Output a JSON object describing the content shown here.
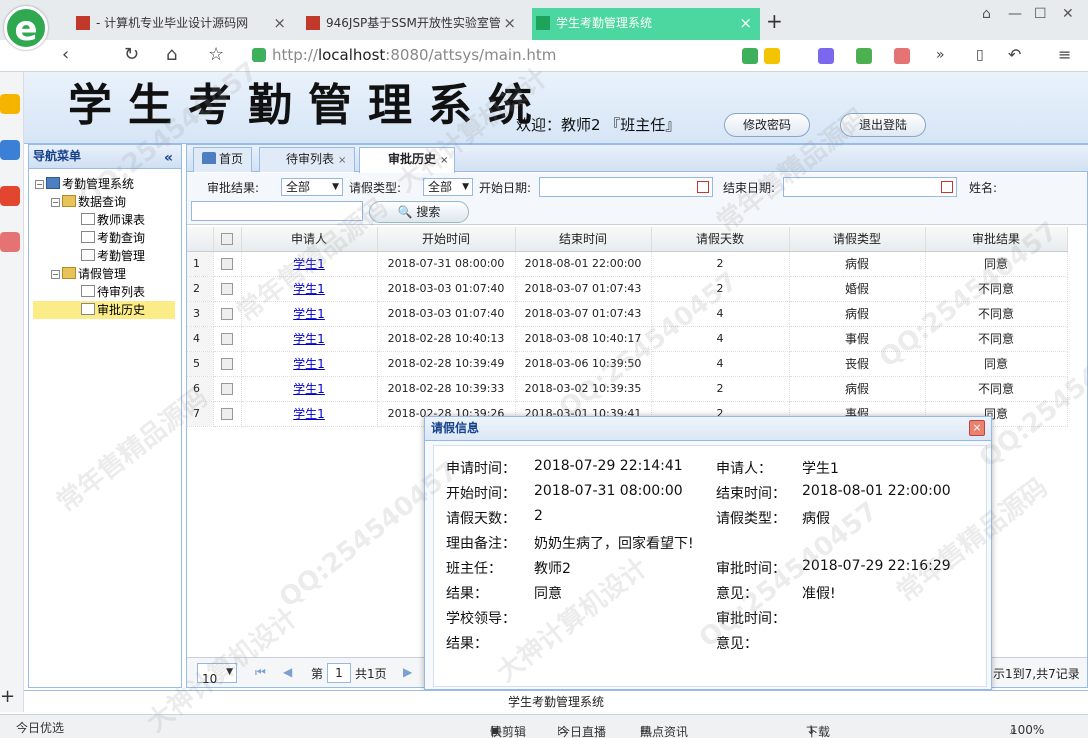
{
  "browser": {
    "tabs": [
      {
        "label": "- 计算机专业毕业设计源码网"
      },
      {
        "label": "946JSP基于SSM开放性实验室管"
      },
      {
        "label": "学生考勤管理系统"
      }
    ],
    "url_host": "http://",
    "url_domain": "localhost",
    "url_path": ":8080/attsys/main.htm",
    "status": {
      "left": "今日优选",
      "kuaijianji": "快剪辑",
      "zhibo": "今日直播",
      "hotnews": "热点资讯",
      "download": "下载",
      "zoom": "100%"
    }
  },
  "header": {
    "title": "学生考勤管理系统",
    "welcome": "欢迎：教师2 『班主任』",
    "change_password": "修改密码",
    "logout": "退出登陆"
  },
  "nav": {
    "title": "导航菜单",
    "collapse": "«",
    "root": "考勤管理系统",
    "group1": "数据查询",
    "g1_item1": "教师课表",
    "g1_item2": "考勤查询",
    "g1_item3": "考勤管理",
    "group2": "请假管理",
    "g2_item1": "待审列表",
    "g2_item2": "审批历史"
  },
  "tabs": {
    "home": "首页",
    "pending": "待审列表",
    "history": "审批历史",
    "close": "×"
  },
  "filter": {
    "result_label": "审批结果:",
    "result_value": "全部",
    "type_label": "请假类型:",
    "type_value": "全部",
    "start_label": "开始日期:",
    "end_label": "结束日期:",
    "name_label": "姓名:",
    "search": "搜索"
  },
  "table": {
    "headers": [
      "申请人",
      "开始时间",
      "结束时间",
      "请假天数",
      "请假类型",
      "审批结果"
    ],
    "rows": [
      {
        "n": "1",
        "name": "学生1",
        "start": "2018-07-31 08:00:00",
        "end": "2018-08-01 22:00:00",
        "days": "2",
        "type": "病假",
        "result": "同意"
      },
      {
        "n": "2",
        "name": "学生1",
        "start": "2018-03-03 01:07:40",
        "end": "2018-03-07 01:07:43",
        "days": "2",
        "type": "婚假",
        "result": "不同意"
      },
      {
        "n": "3",
        "name": "学生1",
        "start": "2018-03-03 01:07:40",
        "end": "2018-03-07 01:07:43",
        "days": "4",
        "type": "病假",
        "result": "不同意"
      },
      {
        "n": "4",
        "name": "学生1",
        "start": "2018-02-28 10:40:13",
        "end": "2018-03-08 10:40:17",
        "days": "4",
        "type": "事假",
        "result": "不同意"
      },
      {
        "n": "5",
        "name": "学生1",
        "start": "2018-02-28 10:39:49",
        "end": "2018-03-06 10:39:50",
        "days": "4",
        "type": "丧假",
        "result": "同意"
      },
      {
        "n": "6",
        "name": "学生1",
        "start": "2018-02-28 10:39:33",
        "end": "2018-03-02 10:39:35",
        "days": "2",
        "type": "病假",
        "result": "不同意"
      },
      {
        "n": "7",
        "name": "学生1",
        "start": "2018-02-28 10:39:26",
        "end": "2018-03-01 10:39:41",
        "days": "2",
        "type": "事假",
        "result": "同意"
      }
    ]
  },
  "pager": {
    "page_size": "10",
    "page_prefix": "第",
    "page_num": "1",
    "page_total": "共1页",
    "summary": "示1到7,共7记录"
  },
  "dialog": {
    "title": "请假信息",
    "close": "×",
    "fields": {
      "apply_time_label": "申请时间：",
      "apply_time": "2018-07-29 22:14:41",
      "applicant_label": "申请人：",
      "applicant": "学生1",
      "start_label": "开始时间：",
      "start": "2018-07-31 08:00:00",
      "end_label": "结束时间：",
      "end": "2018-08-01 22:00:00",
      "days_label": "请假天数：",
      "days": "2",
      "type_label": "请假类型：",
      "type": "病假",
      "reason_label": "理由备注：",
      "reason": "奶奶生病了，回家看望下!",
      "teacher_label": "班主任：",
      "teacher": "教师2",
      "approve_time_label": "审批时间：",
      "approve_time": "2018-07-29 22:16:29",
      "result_label": "结果：",
      "result": "同意",
      "opinion_label": "意见：",
      "opinion": "准假!",
      "leader_label": "学校领导：",
      "approve_time2_label": "审批时间：",
      "result2_label": "结果：",
      "opinion2_label": "意见："
    }
  },
  "footer": "学生考勤管理系统",
  "watermark": [
    "QQ:254540457",
    "常年售精品源码",
    "大神计算机设计"
  ]
}
